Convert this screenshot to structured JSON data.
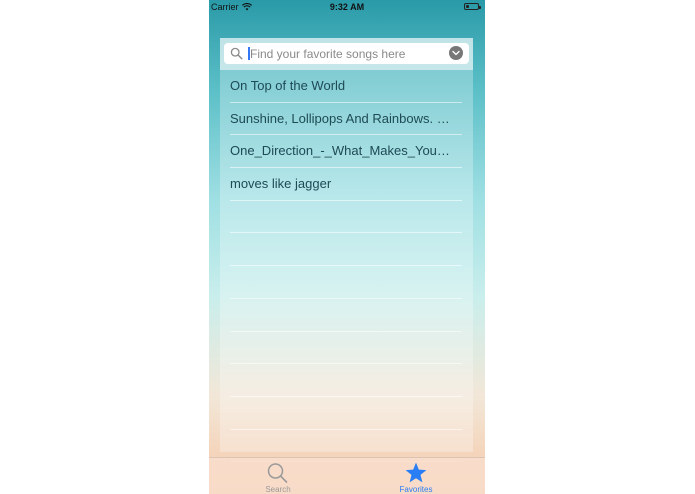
{
  "status_bar": {
    "carrier": "Carrier",
    "time": "9:32 AM"
  },
  "search": {
    "placeholder": "Find your favorite songs here",
    "value": ""
  },
  "songs": [
    "On Top of the World",
    "Sunshine, Lollipops And Rainbows. Lesley Gore",
    "One_Direction_-_What_Makes_You_Beautiful",
    "moves like jagger"
  ],
  "tab_bar": {
    "tabs": [
      {
        "label": "Search",
        "icon": "search-icon",
        "selected": false
      },
      {
        "label": "Favorites",
        "icon": "star-icon",
        "selected": true
      }
    ]
  },
  "colors": {
    "accent": "#2a7ef5",
    "text": "#1e4a55"
  }
}
